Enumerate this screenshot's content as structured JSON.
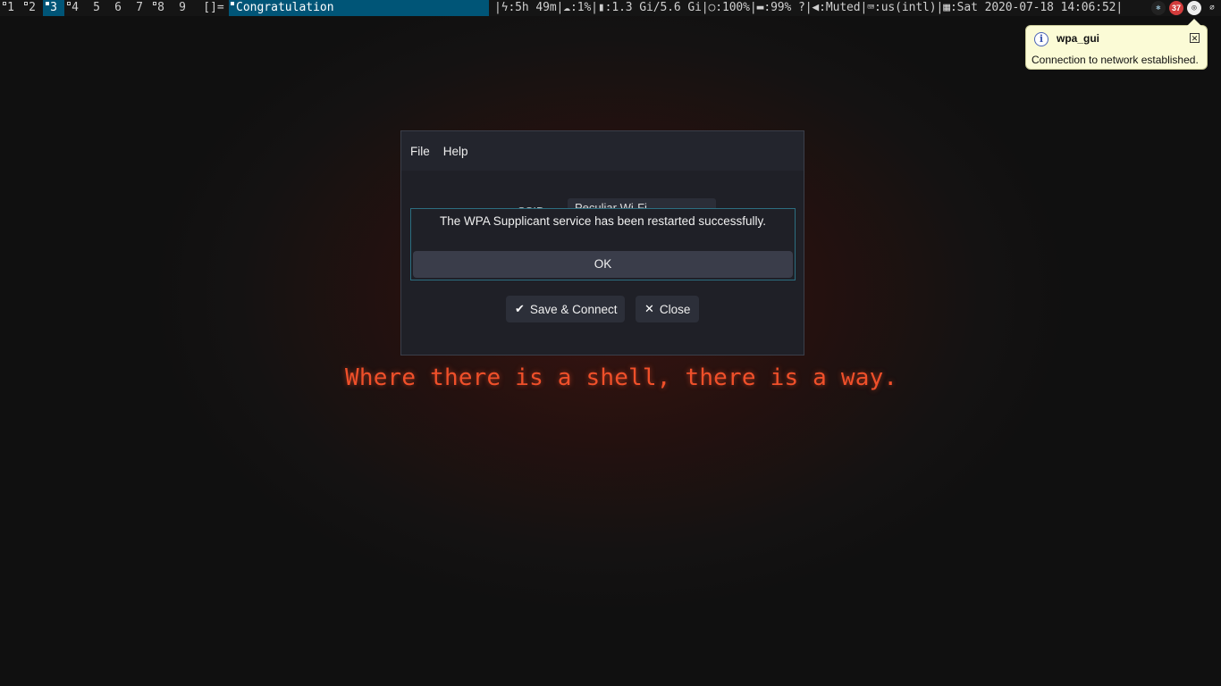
{
  "topbar": {
    "tags": [
      "1",
      "2",
      "3",
      "4",
      "5",
      "6",
      "7",
      "8",
      "9"
    ],
    "active_tag": "3",
    "layout_symbol": "[]=",
    "window_title": "Congratulation",
    "status_text": "|ϟ:5h 49m|☁:1%|▮:1.3 Gi/5.6 Gi|○:100%|▬:99% ?|◀:Muted|⌨:us(intl)|▦:Sat 2020-07-18 14:06:52|",
    "tray": {
      "bluetooth_icon": "bluetooth-icon",
      "badge_count": "37",
      "wifi_icon": "wifi-icon",
      "clip_icon": "paperclip-icon"
    }
  },
  "notification": {
    "app": "wpa_gui",
    "message": "Connection to network established.",
    "icon": "info-icon",
    "close_glyph": "✕"
  },
  "window": {
    "menu": [
      "File",
      "Help"
    ],
    "ssid_label": "SSID",
    "ssid_value": "Peculiar Wi-Fi",
    "message": "The WPA Supplicant service has been restarted successfully.",
    "ok_label": "OK",
    "save_label": "Save & Connect",
    "close_label": "Close"
  },
  "wallpaper": {
    "slogan": "Where there is a shell, there is a way."
  },
  "colors": {
    "accent": "#005577",
    "slogan": "#f0502a",
    "notification_bg": "#fbfbd6",
    "badge": "#d23c3c"
  }
}
